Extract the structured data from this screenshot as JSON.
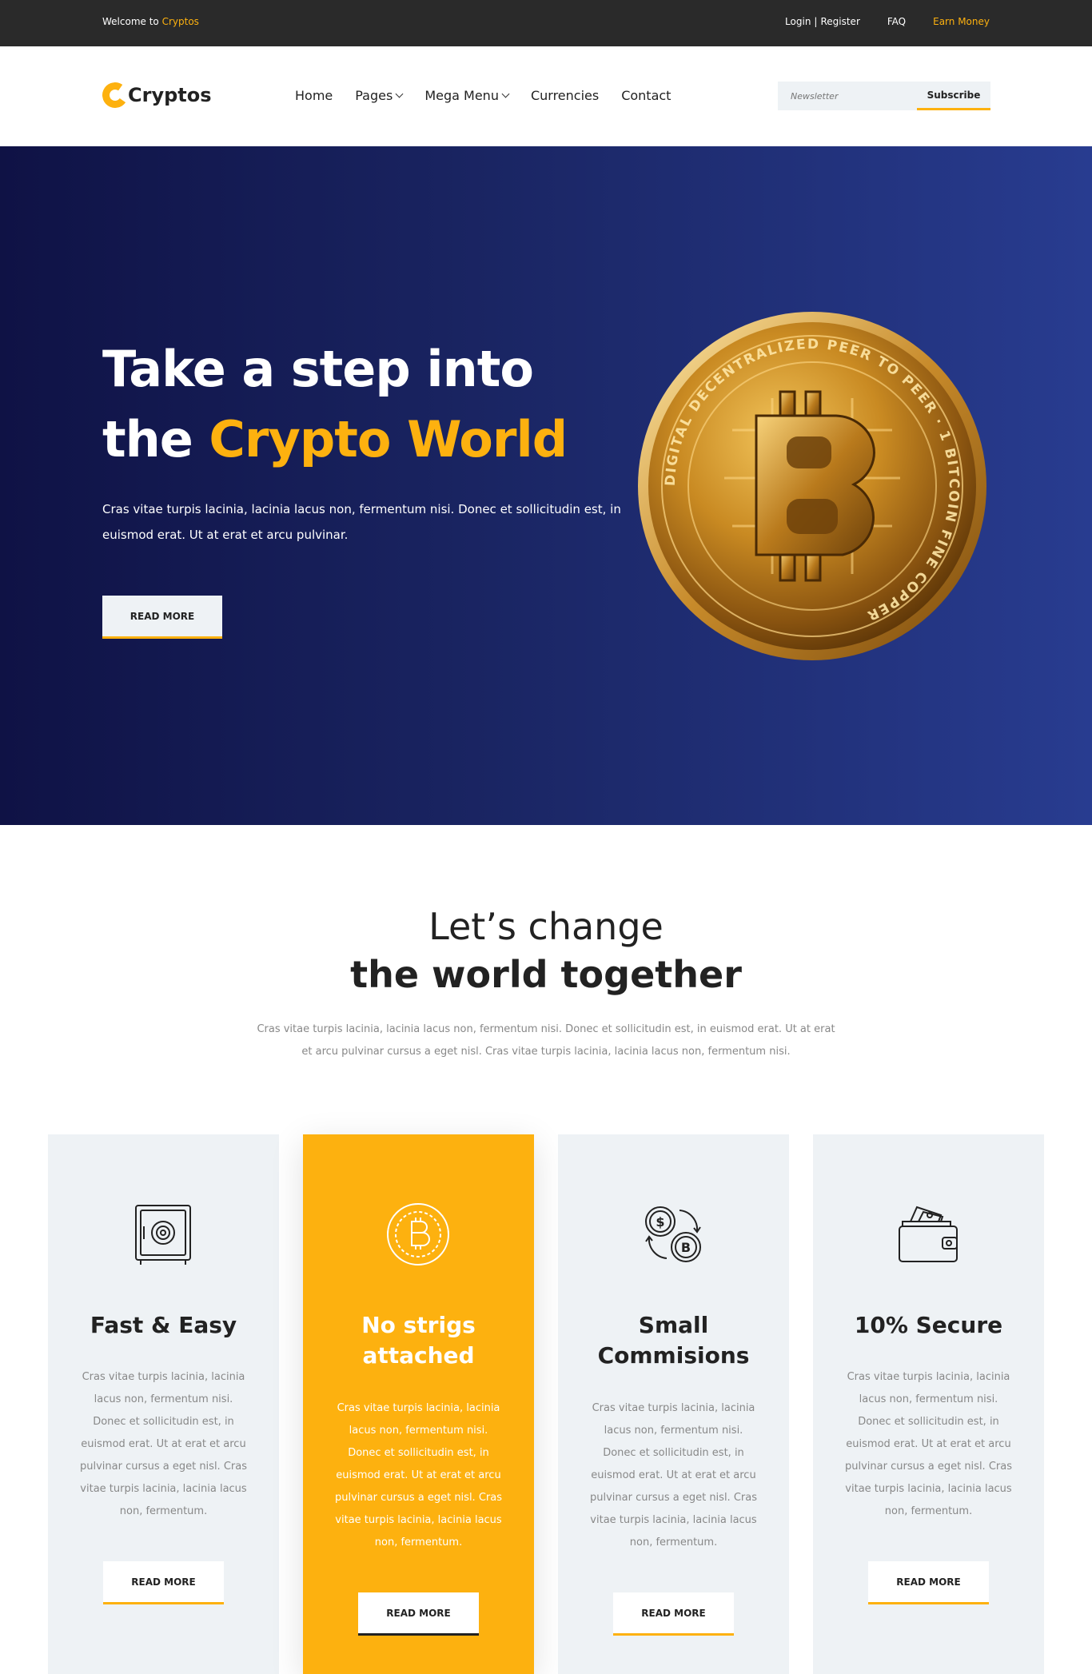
{
  "topbar": {
    "welcome_prefix": "Welcome to",
    "welcome_brand": "Cryptos",
    "login": "Login",
    "separator": "|",
    "register": "Register",
    "faq": "FAQ",
    "earn": "Earn Money"
  },
  "header": {
    "logo": "Cryptos",
    "nav": [
      "Home",
      "Pages",
      "Mega Menu",
      "Currencies",
      "Contact"
    ],
    "newsletter_placeholder": "Newsletter",
    "subscribe": "Subscribe"
  },
  "hero": {
    "title_line1": "Take a step into",
    "title_line2_prefix": "the",
    "title_line2_accent": "Crypto World",
    "text": "Cras vitae turpis lacinia, lacinia lacus non, fermentum nisi. Donec et sollicitudin est, in euismod erat. Ut at erat et arcu pulvinar.",
    "button": "READ MORE",
    "coin_text": "DIGITAL DECENTRALIZED PEER TO PEER · 1 BITCOIN FINE COPPER"
  },
  "intro": {
    "line1": "Let’s change",
    "line2_bold": "the world",
    "line2_rest": "together",
    "text": "Cras vitae turpis lacinia, lacinia lacus non, fermentum nisi. Donec et sollicitudin est, in euismod erat. Ut at erat et arcu pulvinar cursus a eget nisl. Cras vitae turpis lacinia, lacinia lacus non, fermentum nisi."
  },
  "cards": [
    {
      "icon": "safe-icon",
      "title_line1": "Fast & Easy",
      "title_line2": "",
      "text": "Cras vitae turpis lacinia, lacinia lacus non, fermentum nisi. Donec et sollicitudin est, in euismod erat. Ut at erat et arcu pulvinar cursus a eget nisl. Cras vitae turpis lacinia, lacinia lacus non, fermentum.",
      "button": "READ MORE"
    },
    {
      "icon": "bitcoin-coin-icon",
      "title_line1": "No strigs",
      "title_line2": "attached",
      "text": "Cras vitae turpis lacinia, lacinia lacus non, fermentum nisi. Donec et sollicitudin est, in euismod erat. Ut at erat et arcu pulvinar cursus a eget nisl. Cras vitae turpis lacinia, lacinia lacus non, fermentum.",
      "button": "READ MORE"
    },
    {
      "icon": "currency-exchange-icon",
      "title_line1": "Small",
      "title_line2": "Commisions",
      "text": "Cras vitae turpis lacinia, lacinia lacus non, fermentum nisi. Donec et sollicitudin est, in euismod erat. Ut at erat et arcu pulvinar cursus a eget nisl. Cras vitae turpis lacinia, lacinia lacus non, fermentum.",
      "button": "READ MORE"
    },
    {
      "icon": "wallet-icon",
      "title_line1": "10% Secure",
      "title_line2": "",
      "text": "Cras vitae turpis lacinia, lacinia lacus non, fermentum nisi. Donec et sollicitudin est, in euismod erat. Ut at erat et arcu pulvinar cursus a eget nisl. Cras vitae turpis lacinia, lacinia lacus non, fermentum.",
      "button": "READ MORE"
    }
  ],
  "colors": {
    "accent": "#fdb10f",
    "topbar": "#2a2a2a",
    "hero_dark": "#0f1245",
    "hero_light": "#283c90",
    "card_bg": "#eef2f5"
  }
}
